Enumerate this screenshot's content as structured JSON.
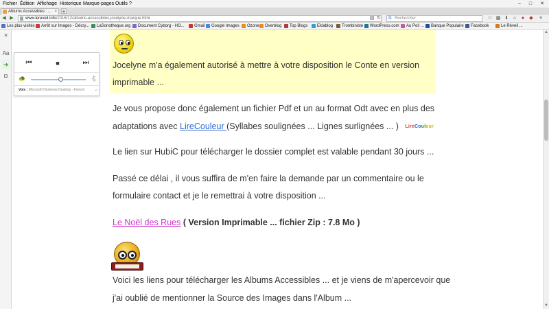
{
  "menu": [
    "Fichier",
    "Édition",
    "Affichage",
    "Historique",
    "Marque-pages",
    "Outils",
    "?"
  ],
  "window_controls": [
    "–",
    "□",
    "✕"
  ],
  "tab": {
    "title": "Albums Accessibles : ...",
    "close": "×",
    "new_tab": "+"
  },
  "url": {
    "host": "www.lereveil.info",
    "path": "/2016/12/albums-accessibles-jocelyne-marque.html"
  },
  "search": {
    "engine_glyph": "G",
    "placeholder": "Rechercher"
  },
  "bookmarks": [
    {
      "label": "Les plus visités",
      "color": "#4a74c9"
    },
    {
      "label": "Arrêt sur Images - Décry...",
      "color": "#c43b3b"
    },
    {
      "label": "LaSonotheque.org",
      "color": "#3a8f5c"
    },
    {
      "label": "Document Cyborg - HO...",
      "color": "#7a6bc4"
    },
    {
      "label": "Gmail",
      "color": "#d93025"
    },
    {
      "label": "Google Images",
      "color": "#4285f4"
    },
    {
      "label": "Ozone",
      "color": "#e88c1a"
    },
    {
      "label": "Overblog",
      "color": "#f08a24"
    },
    {
      "label": "Top Blogs",
      "color": "#b03a3a"
    },
    {
      "label": "Eklablog",
      "color": "#3a9bd1"
    },
    {
      "label": "Trombiniste",
      "color": "#7b5b3a"
    },
    {
      "label": "WordPress.com",
      "color": "#21759b"
    },
    {
      "label": "Au Poil ...",
      "color": "#c45aa0"
    },
    {
      "label": "Banque Populaire",
      "color": "#1c4f9c"
    },
    {
      "label": "Facebook",
      "color": "#3b5998"
    },
    {
      "label": "Le Réveil ...",
      "color": "#d67a1a"
    }
  ],
  "left_toolbar": {
    "close": "✕",
    "font": "Aa",
    "listen": "➜",
    "pocket": "◘"
  },
  "audio_panel": {
    "back": "⏮",
    "stop": "■",
    "forward": "⏭",
    "slow": "🐢",
    "fast": "🐇",
    "speed": 0.55,
    "voice_label": "Voix :",
    "voice_value": "Microsoft Hortense Desktop - French",
    "voice_chevron": "⌄"
  },
  "content": {
    "p1_line1": "Jocelyne m'a également autorisé à mettre à votre disposition le Conte en version",
    "p1_line2": "imprimable   ...",
    "p2_line1": "Je vous propose donc également  un fichier Pdf et un au format Odt avec en plus des",
    "p2_line2_pre": "adaptations avec ",
    "p2_link": "LireCouleur ",
    "p2_line2_post": " (Syllabes soulignées ... Lignes surlignées  ... )",
    "logo": {
      "l1": "Lire",
      "l2": "Co",
      "l3": "ul",
      "l4": "eur"
    },
    "p3": "Le lien sur HubiC   pour télécharger le dossier complet  est valable pendant 30 jours ...",
    "p4_line1": "Passé ce délai , il vous suffira de m'en faire la demande par un commentaire ou le",
    "p4_line2": "formulaire contact et je le remettrai à votre disposition ...",
    "p5_link": "Le Noël des Rues",
    "p5_rest": "  ( Version Imprimable ... fichier Zip : 7.8 Mo )",
    "p6_line1": "Voici les liens pour télécharger les Albums Accessibles ... et je viens de m'apercevoir que",
    "p6_line2": "j'ai oublié de mentionner  la Source des Images dans l'Album ..."
  },
  "scrollbar": {
    "up": "▲",
    "down": "▼",
    "position": 0.28
  }
}
